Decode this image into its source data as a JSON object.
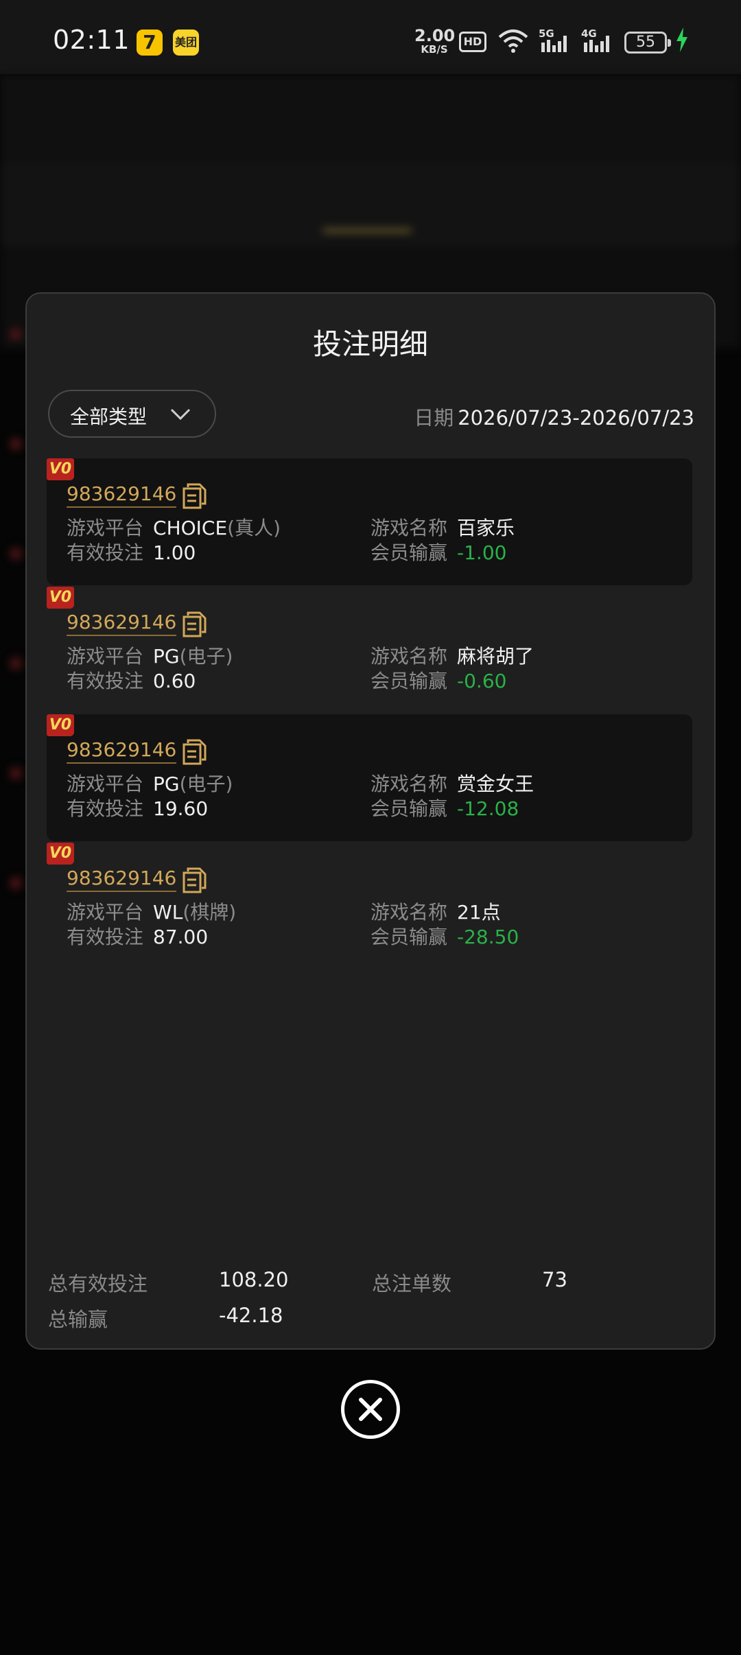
{
  "status_bar": {
    "time": "02:11",
    "app_icon_1": "7",
    "app_icon_2": "美团",
    "net_speed_value": "2.00",
    "net_speed_unit": "KB/S",
    "hd_label": "HD",
    "signal_1": "5G",
    "signal_2": "4G",
    "battery": "55"
  },
  "modal": {
    "title": "投注明细",
    "type_filter": "全部类型",
    "date_label": "日期",
    "date_value": "2026/07/23-2026/07/23",
    "labels": {
      "platform": "游戏平台",
      "game_name": "游戏名称",
      "valid_bet": "有效投注",
      "member_winloss": "会员输赢"
    },
    "records": [
      {
        "vip": "V0",
        "id": "983629146",
        "platform": "CHOICE",
        "platform_type": "(真人)",
        "game": "百家乐",
        "valid_bet": "1.00",
        "winloss": "-1.00"
      },
      {
        "vip": "V0",
        "id": "983629146",
        "platform": "PG",
        "platform_type": "(电子)",
        "game": "麻将胡了",
        "valid_bet": "0.60",
        "winloss": "-0.60"
      },
      {
        "vip": "V0",
        "id": "983629146",
        "platform": "PG",
        "platform_type": "(电子)",
        "game": "赏金女王",
        "valid_bet": "19.60",
        "winloss": "-12.08"
      },
      {
        "vip": "V0",
        "id": "983629146",
        "platform": "WL",
        "platform_type": "(棋牌)",
        "game": "21点",
        "valid_bet": "87.00",
        "winloss": "-28.50"
      }
    ],
    "summary": {
      "total_valid_bet_label": "总有效投注",
      "total_valid_bet": "108.20",
      "total_orders_label": "总注单数",
      "total_orders": "73",
      "total_winloss_label": "总输赢",
      "total_winloss": "-42.18"
    }
  },
  "colors": {
    "accent_gold": "#d3a85a",
    "negative_green": "#29b24a",
    "badge_red": "#b8231f"
  },
  "icons": {
    "copy": "copy-icon",
    "chevron": "chevron-down-icon",
    "close": "close-icon"
  }
}
